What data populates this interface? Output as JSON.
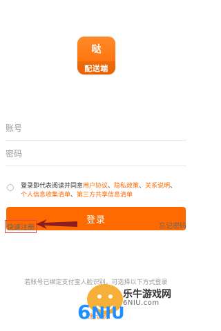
{
  "logo": {
    "mark": "哒",
    "subtitle": "配送端"
  },
  "form": {
    "account_placeholder": "账号",
    "password_placeholder": "密码"
  },
  "agreement": {
    "prefix": "登录即代表阅读并同意",
    "links": [
      "用户协议",
      "隐私政策",
      "关系说明",
      "个人信息收集清单",
      "第三方共享信息清单"
    ],
    "separators": [
      "、",
      "、",
      "、",
      "、"
    ]
  },
  "buttons": {
    "login": "登录"
  },
  "footer": {
    "quick_register": "快速注册",
    "forgot_password": "忘记密码",
    "notice": "若账号已绑定支付宝人脸识别，可选择以下方式登录",
    "face_login": "人脸识别"
  },
  "watermark": {
    "brand": "乐牛游戏网",
    "url": "6NIU.com"
  },
  "colors": {
    "accent": "#ff6a00",
    "annotation_red": "#e04a4a",
    "arrow": "#8b1d1d"
  }
}
